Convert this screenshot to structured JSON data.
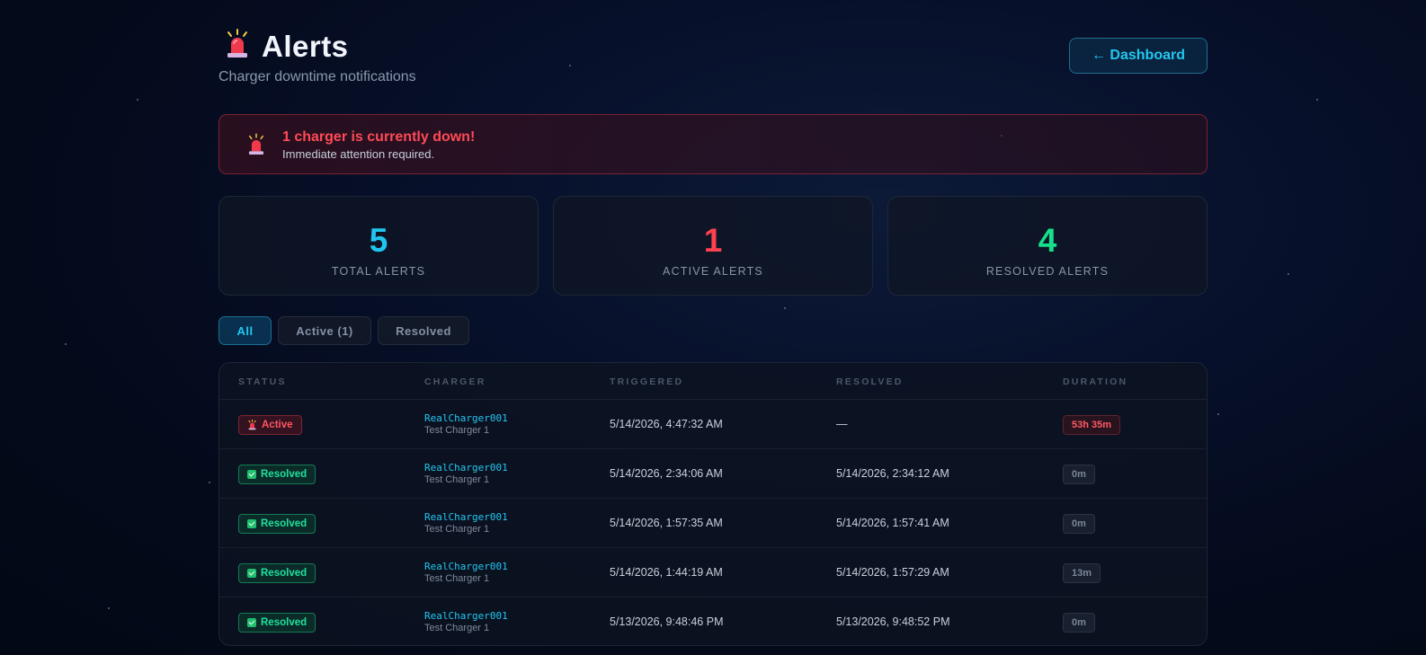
{
  "header": {
    "icon": "siren-icon",
    "title": "Alerts",
    "subtitle": "Charger downtime notifications",
    "dashboard_button": "← Dashboard"
  },
  "banner": {
    "icon": "siren-icon",
    "title": "1 charger is currently down!",
    "text": "Immediate attention required."
  },
  "stats": [
    {
      "value": "5",
      "label": "TOTAL ALERTS",
      "color": "#21c4ef"
    },
    {
      "value": "1",
      "label": "ACTIVE ALERTS",
      "color": "#ff4150"
    },
    {
      "value": "4",
      "label": "RESOLVED ALERTS",
      "color": "#16e08a"
    }
  ],
  "filters": [
    {
      "label": "All",
      "selected": true
    },
    {
      "label": "Active (1)",
      "selected": false
    },
    {
      "label": "Resolved",
      "selected": false
    }
  ],
  "table": {
    "columns": [
      "STATUS",
      "CHARGER",
      "TRIGGERED",
      "RESOLVED",
      "DURATION"
    ],
    "rows": [
      {
        "status": "Active",
        "charger": "RealCharger001",
        "charger_name": "Test Charger 1",
        "triggered": "5/14/2026, 4:47:32 AM",
        "resolved": "—",
        "duration": "53h 35m"
      },
      {
        "status": "Resolved",
        "charger": "RealCharger001",
        "charger_name": "Test Charger 1",
        "triggered": "5/14/2026, 2:34:06 AM",
        "resolved": "5/14/2026, 2:34:12 AM",
        "duration": "0m"
      },
      {
        "status": "Resolved",
        "charger": "RealCharger001",
        "charger_name": "Test Charger 1",
        "triggered": "5/14/2026, 1:57:35 AM",
        "resolved": "5/14/2026, 1:57:41 AM",
        "duration": "0m"
      },
      {
        "status": "Resolved",
        "charger": "RealCharger001",
        "charger_name": "Test Charger 1",
        "triggered": "5/14/2026, 1:44:19 AM",
        "resolved": "5/14/2026, 1:57:29 AM",
        "duration": "13m"
      },
      {
        "status": "Resolved",
        "charger": "RealCharger001",
        "charger_name": "Test Charger 1",
        "triggered": "5/13/2026, 9:48:46 PM",
        "resolved": "5/13/2026, 9:48:52 PM",
        "duration": "0m"
      }
    ]
  }
}
